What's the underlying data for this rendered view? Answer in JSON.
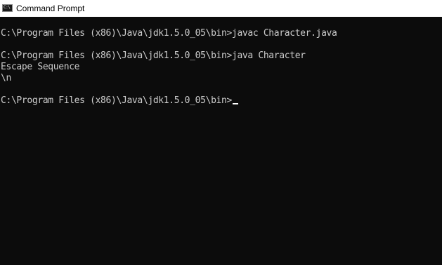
{
  "window": {
    "title": "Command Prompt",
    "icon": "cmd-prompt-icon",
    "icon_glyph": "C:\\"
  },
  "console": {
    "lines": [
      "",
      "C:\\Program Files (x86)\\Java\\jdk1.5.0_05\\bin>javac Character.java",
      "",
      "C:\\Program Files (x86)\\Java\\jdk1.5.0_05\\bin>java Character",
      "Escape Sequence",
      "\\n",
      "",
      "C:\\Program Files (x86)\\Java\\jdk1.5.0_05\\bin>"
    ],
    "background": "#0c0c0c",
    "foreground": "#cccccc"
  }
}
